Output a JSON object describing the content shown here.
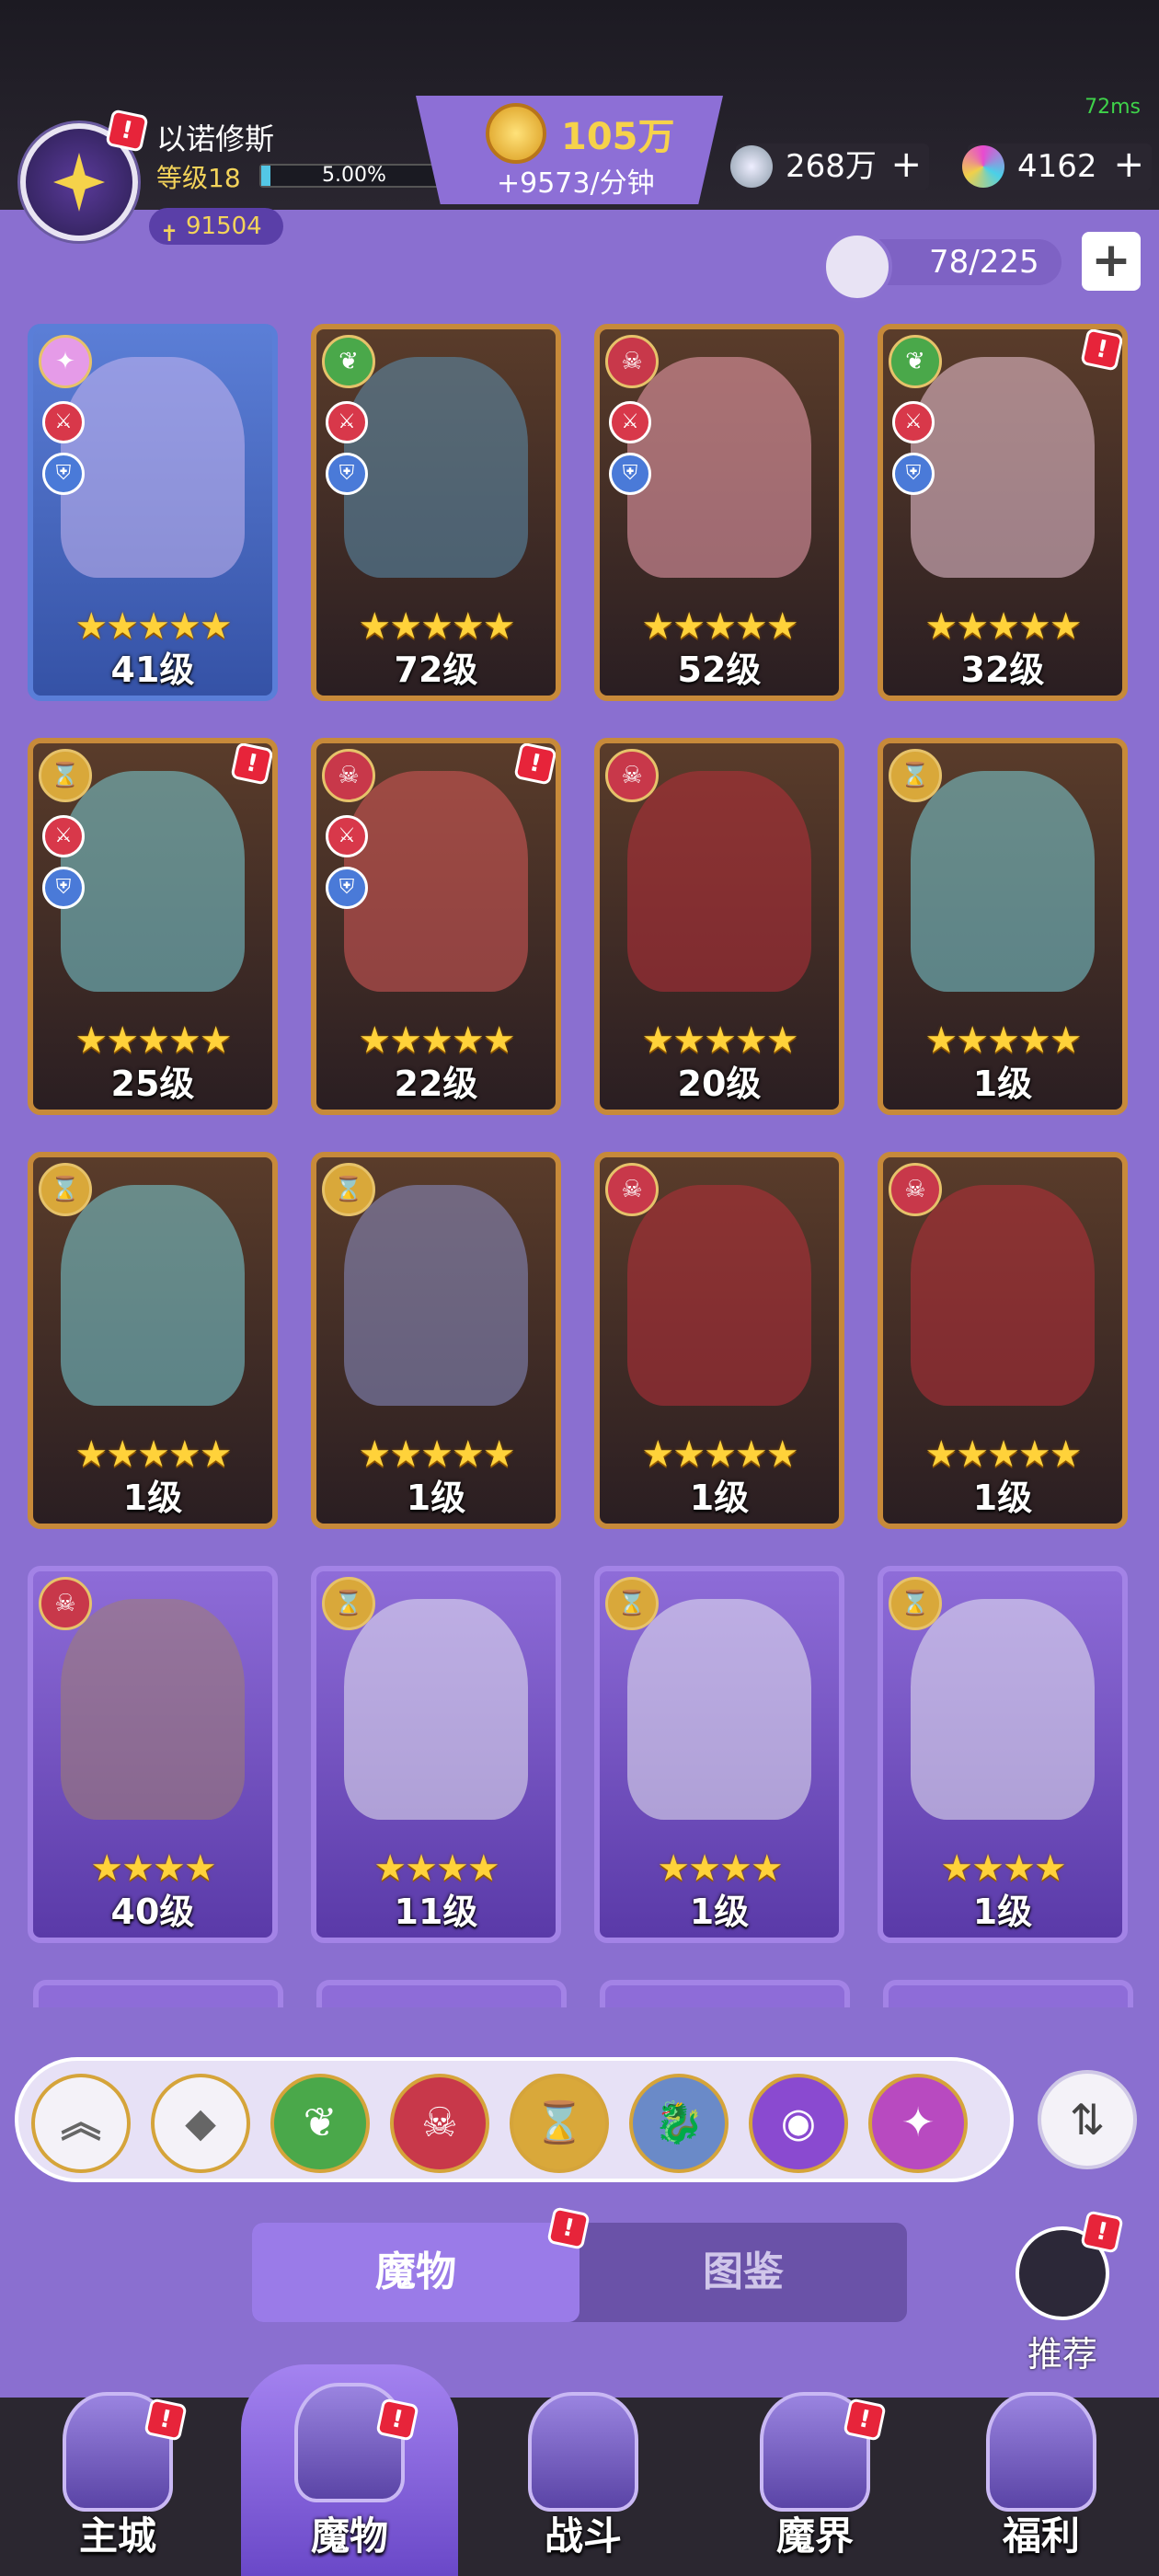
{
  "status": {
    "latency": "72ms"
  },
  "player": {
    "name": "以诺修斯",
    "level": "等级18",
    "xp_percent_text": "5.00%",
    "xp_fraction": 0.05,
    "power": "91504"
  },
  "gold": {
    "amount": "105万",
    "rate": "+9573/分钟"
  },
  "resources": [
    {
      "icon": "silver-orb-icon",
      "amount": "268万",
      "plus": "+"
    },
    {
      "icon": "crystal-gem-icon",
      "amount": "4162",
      "plus": "+"
    }
  ],
  "roster": {
    "count": "78/225",
    "plus": "+"
  },
  "cards": [
    {
      "level": "41级",
      "stars": "★★★★★",
      "frame": "blue",
      "element": "cosmic",
      "element_color": "#e59be8",
      "roles": [
        "sword",
        "shield"
      ],
      "badge": false,
      "portrait": "#c9b6f0"
    },
    {
      "level": "72级",
      "stars": "★★★★★",
      "frame": "gold",
      "element": "nature",
      "element_color": "#4aa84a",
      "roles": [
        "sword",
        "shield"
      ],
      "badge": false,
      "portrait": "#5b8fb0"
    },
    {
      "level": "52级",
      "stars": "★★★★★",
      "frame": "gold",
      "element": "demon",
      "element_color": "#c8384a",
      "roles": [
        "sword",
        "shield"
      ],
      "badge": false,
      "portrait": "#f0a0b0"
    },
    {
      "level": "32级",
      "stars": "★★★★★",
      "frame": "gold",
      "element": "nature",
      "element_color": "#4aa84a",
      "roles": [
        "sword",
        "shield"
      ],
      "badge": true,
      "portrait": "#f0c8d8"
    },
    {
      "level": "25级",
      "stars": "★★★★★",
      "frame": "gold",
      "element": "time",
      "element_color": "#d9a83a",
      "roles": [
        "sword",
        "shield"
      ],
      "badge": true,
      "portrait": "#7ad0d8"
    },
    {
      "level": "22级",
      "stars": "★★★★★",
      "frame": "gold",
      "element": "demon",
      "element_color": "#c8384a",
      "roles": [
        "sword",
        "shield"
      ],
      "badge": true,
      "portrait": "#d85a5a"
    },
    {
      "level": "20级",
      "stars": "★★★★★",
      "frame": "gold",
      "element": "demon",
      "element_color": "#c8384a",
      "roles": [],
      "badge": false,
      "portrait": "#b8303a"
    },
    {
      "level": "1级",
      "stars": "★★★★★",
      "frame": "gold",
      "element": "time",
      "element_color": "#d9a83a",
      "roles": [],
      "badge": false,
      "portrait": "#7ad0d8"
    },
    {
      "level": "1级",
      "stars": "★★★★★",
      "frame": "gold",
      "element": "time",
      "element_color": "#d9a83a",
      "roles": [],
      "badge": false,
      "portrait": "#7ad0d8"
    },
    {
      "level": "1级",
      "stars": "★★★★★",
      "frame": "gold",
      "element": "time",
      "element_color": "#d9a83a",
      "roles": [],
      "badge": false,
      "portrait": "#8a90c8"
    },
    {
      "level": "1级",
      "stars": "★★★★★",
      "frame": "gold",
      "element": "demon",
      "element_color": "#c8384a",
      "roles": [],
      "badge": false,
      "portrait": "#b8303a"
    },
    {
      "level": "1级",
      "stars": "★★★★★",
      "frame": "gold",
      "element": "demon",
      "element_color": "#c8384a",
      "roles": [],
      "badge": false,
      "portrait": "#b8303a"
    },
    {
      "level": "40级",
      "stars": "★★★★",
      "frame": "purple",
      "element": "demon",
      "element_color": "#c8384a",
      "roles": [],
      "badge": false,
      "portrait": "#a08070"
    },
    {
      "level": "11级",
      "stars": "★★★★",
      "frame": "purple",
      "element": "time",
      "element_color": "#d9a83a",
      "roles": [],
      "badge": false,
      "portrait": "#e8e8f0"
    },
    {
      "level": "1级",
      "stars": "★★★★",
      "frame": "purple",
      "element": "time",
      "element_color": "#d9a83a",
      "roles": [],
      "badge": false,
      "portrait": "#e8e8f0"
    },
    {
      "level": "1级",
      "stars": "★★★★",
      "frame": "purple",
      "element": "time",
      "element_color": "#d9a83a",
      "roles": [],
      "badge": false,
      "portrait": "#e8e8f0"
    }
  ],
  "filters": [
    {
      "name": "collapse",
      "glyph": "︽",
      "color": "#f4f2f8"
    },
    {
      "name": "all",
      "glyph": "◆",
      "color": "#f4f2f8"
    },
    {
      "name": "nature",
      "glyph": "❦",
      "color": "#4aa84a"
    },
    {
      "name": "demon",
      "glyph": "☠",
      "color": "#c8384a"
    },
    {
      "name": "time",
      "glyph": "⌛",
      "color": "#d9a83a"
    },
    {
      "name": "beast",
      "glyph": "🐉",
      "color": "#6a8ac8"
    },
    {
      "name": "eye",
      "glyph": "◉",
      "color": "#8a4ad0"
    },
    {
      "name": "cosmic",
      "glyph": "✦",
      "color": "#b84ac0"
    }
  ],
  "sort_glyph": "⇅",
  "tabs": {
    "active": "魔物",
    "inactive": "图鉴"
  },
  "recommend": {
    "label": "推荐"
  },
  "nav": [
    {
      "label": "主城",
      "icon": "castle-icon"
    },
    {
      "label": "魔物",
      "icon": "monster-flame-icon"
    },
    {
      "label": "战斗",
      "icon": "battle-shield-icon"
    },
    {
      "label": "魔界",
      "icon": "demon-realm-icon"
    },
    {
      "label": "福利",
      "icon": "treasure-chest-icon"
    }
  ],
  "colors": {
    "background": "#8a6fd0",
    "accent_gold": "#f6d24a",
    "alert_red": "#e7243a"
  }
}
